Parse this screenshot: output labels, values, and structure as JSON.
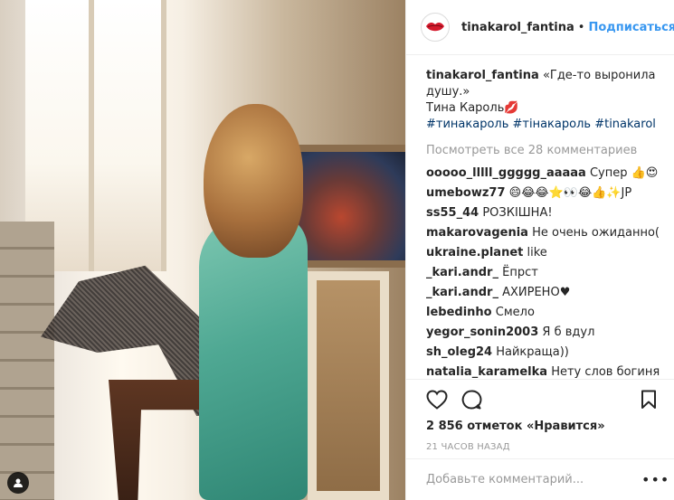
{
  "header": {
    "username": "tinakarol_fantina",
    "separator": "•",
    "follow_label": "Подписаться"
  },
  "caption": {
    "username": "tinakarol_fantina",
    "text_line1": "«Где-то выронила",
    "text_line2": "душу.»",
    "text_line3": "Тина Кароль💋",
    "hashtags": [
      "#тинакароль",
      "#тінакароль",
      "#tinakarol"
    ]
  },
  "view_all_comments": "Посмотреть все 28 комментариев",
  "comments": [
    {
      "user": "ooooo_lllll_ggggg_aaaaa",
      "text": "Супер 👍😍"
    },
    {
      "user": "umebowz77",
      "text": "😄😂😂⭐👀😂👍✨JP"
    },
    {
      "user": "ss55_44",
      "text": "РОЗКІШНА!"
    },
    {
      "user": "makarovagenia",
      "text": "Не очень ожиданно("
    },
    {
      "user": "ukraine.planet",
      "text": "like"
    },
    {
      "user": "_kari.andr_",
      "text": "Ёпрст"
    },
    {
      "user": "_kari.andr_",
      "text": "АХИРЕНО♥"
    },
    {
      "user": "lebedinho",
      "text": "Смело"
    },
    {
      "user": "yegor_sonin2003",
      "text": "Я б вдул"
    },
    {
      "user": "sh_oleg24",
      "text": "Найкраща))"
    },
    {
      "user": "natalia_karamelka",
      "text": "Нету слов богиня"
    }
  ],
  "actions": {
    "like_icon": "heart-outline-icon",
    "comment_icon": "comment-bubble-icon",
    "save_icon": "bookmark-icon"
  },
  "likes_text": "2 856 отметок «Нравится»",
  "time_text": "21 часов назад",
  "add_comment_placeholder": "Добавьте комментарий...",
  "more_label": "•••",
  "colors": {
    "link": "#3897f0",
    "hashtag": "#003569",
    "muted": "#999999",
    "text": "#262626",
    "border": "#efefef"
  }
}
